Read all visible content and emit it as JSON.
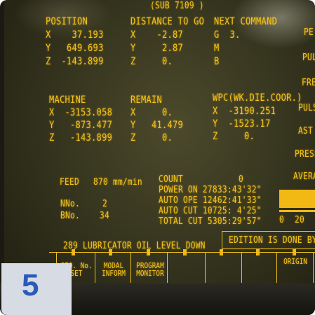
{
  "header": {
    "sub_title": "(SUB 7109 )"
  },
  "position": {
    "title": "POSITION",
    "x": "X    37.193",
    "y": "Y   649.693",
    "z": "Z  -143.899"
  },
  "distance": {
    "title": "DISTANCE TO GO",
    "x": "X    -2.87",
    "y": "Y     2.87",
    "z": "Z     0."
  },
  "next_command": {
    "title": "NEXT COMMAND",
    "g": "G  3.",
    "m": "M",
    "b": "B"
  },
  "machine": {
    "title": "MACHINE",
    "x": "X  -3153.058",
    "y": "Y   -873.477",
    "z": "Z   -143.899"
  },
  "remain": {
    "title": "REMAIN",
    "x": "X     0.",
    "y": "Y   41.479",
    "z": "Z     0."
  },
  "wpc": {
    "title": "WPC(WK.DIE.COOR.)",
    "x": "X  -3190.251",
    "y": "Y  -1523.17",
    "z": "Z     0."
  },
  "feed": {
    "label": "FEED",
    "value": "870 mm/min"
  },
  "nno": {
    "label": "NNo.",
    "value": "2"
  },
  "bno": {
    "label": "BNo.",
    "value": "34"
  },
  "count": {
    "label": "COUNT",
    "value": "0"
  },
  "times": {
    "power_on": "POWER ON 27833:43'32\"",
    "auto_ope": "AUTO OPE 12462:41'33\"",
    "auto_cut": "AUTO CUT 10725: 4'25\"",
    "total_cut": "TOTAL CUT 5305:29'57\""
  },
  "right_panel": {
    "labels": [
      "PE",
      "PUL",
      "FRE",
      "PULS",
      "AST",
      "PRESS",
      "AVERA"
    ],
    "bar_values": [
      "0",
      "20"
    ]
  },
  "alarm_message": "289 LUBRICATOR OIL LEVEL DOWN",
  "status_box": "EDITION IS DONE BY CU",
  "softkeys": [
    "SEQ. No.\nSET",
    "MODAL\nINFORM",
    "PROGRAM\nMONITOR",
    "",
    "",
    "",
    "ORIGIN"
  ],
  "badge_number": "5",
  "colors": {
    "text": "#f2c21a",
    "screen": "#37361f",
    "badge_bg": "#d7dbe4",
    "badge_text": "#2a5bb8"
  }
}
